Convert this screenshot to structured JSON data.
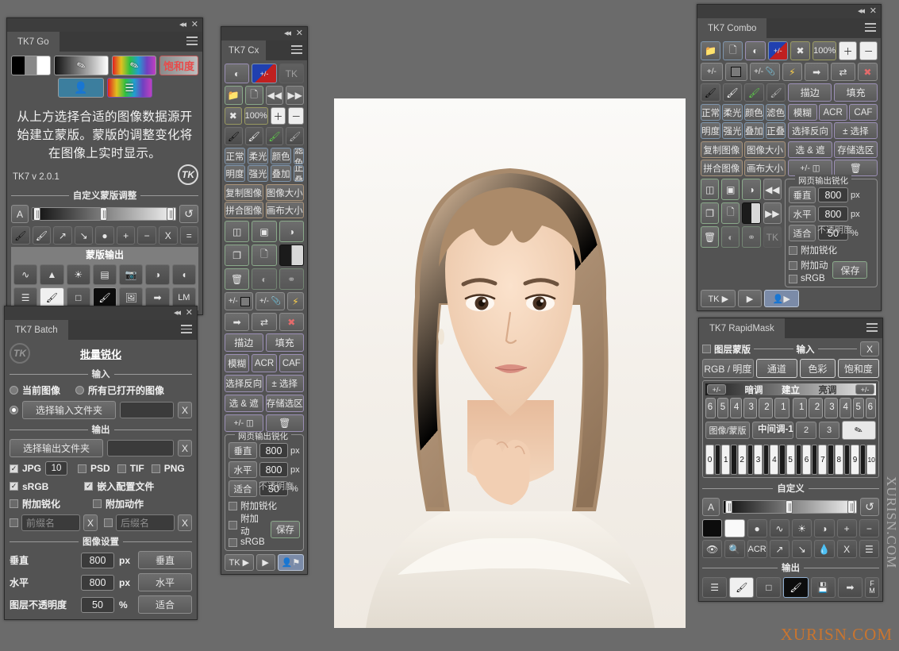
{
  "app": {
    "background": "#6b6b6b"
  },
  "watermark": {
    "text": "XURISN.COM",
    "vertical_text": "XURISN.COM",
    "color": "#d2762a"
  },
  "tk7go": {
    "title": "TK7 Go",
    "sources": [
      {
        "name": "bw-ramp",
        "label": ""
      },
      {
        "name": "luminosity-pipette",
        "label": ""
      },
      {
        "name": "color-pipette",
        "label": ""
      },
      {
        "name": "saturation",
        "label": "饱和度"
      },
      {
        "name": "person",
        "label": ""
      },
      {
        "name": "layers",
        "label": ""
      }
    ],
    "message": "从上方选择合适的图像数据源开始建立蒙版。蒙版的调整变化将在图像上实时显示。",
    "version": "TK7 v 2.0.1",
    "custom_title": "自定义蒙版调整",
    "slider_letter": "A",
    "slider_reset": "↺",
    "tool_row": [
      "brush-black",
      "brush-white",
      "expand",
      "contract",
      "invert",
      "+",
      "−",
      "X",
      "="
    ],
    "output_title": "蒙版输出",
    "output_row1": [
      "curves-icon",
      "levels-icon",
      "brightness-icon",
      "gradient-icon",
      "camera-icon",
      "color-fill-icon",
      "half-tone-icon"
    ],
    "output_row2": [
      "menu-icon",
      "brush-light-icon",
      "marquee-icon",
      "brush-dark-icon",
      "image-icon",
      "apply-icon",
      "LM"
    ]
  },
  "tk7batch": {
    "title": "TK7 Batch",
    "heading": "批量锐化",
    "input_title": "输入",
    "radio_current": "当前图像",
    "radio_allopen": "所有已打开的图像",
    "btn_input_folder": "选择输入文件夹",
    "input_path": "",
    "clear_x": "X",
    "output_title": "输出",
    "btn_output_folder": "选择输出文件夹",
    "output_path": "",
    "formats": [
      {
        "label": "JPG",
        "checked": true,
        "quality": "10"
      },
      {
        "label": "PSD",
        "checked": false
      },
      {
        "label": "TIF",
        "checked": false
      },
      {
        "label": "PNG",
        "checked": false
      }
    ],
    "srgb": {
      "label": "sRGB",
      "checked": true
    },
    "embed": {
      "label": "嵌入配置文件",
      "checked": true
    },
    "extra_sharpen": {
      "label": "附加锐化",
      "checked": false
    },
    "extra_action": {
      "label": "附加动作",
      "checked": false
    },
    "prefix_placeholder": "前缀名",
    "suffix_placeholder": "后缀名",
    "image_settings_title": "图像设置",
    "rows": [
      {
        "label": "垂直",
        "value": "800",
        "unit": "px",
        "button": "垂直"
      },
      {
        "label": "水平",
        "value": "800",
        "unit": "px",
        "button": "水平"
      },
      {
        "label": "图层不透明度",
        "value": "50",
        "unit": "%",
        "button": "适合"
      }
    ]
  },
  "tk7cx": {
    "title": "TK7 Cx",
    "row_top": [
      "curve-ball-icon",
      "plus-minus-color-icon",
      "tk-logo"
    ],
    "row_file": [
      "open-folder-icon",
      "new-doc-icon",
      "rewind-icon",
      "forward-icon"
    ],
    "row_zoom": [
      "fit-icon",
      "100%",
      "zoom-in-icon",
      "zoom-out-icon"
    ],
    "row_brush": [
      "brush-black-icon",
      "brush-white-icon",
      "brush-green-icon",
      "brush-gray-icon"
    ],
    "blend_row1": [
      "正常",
      "柔光",
      "颜色",
      "滤色"
    ],
    "blend_row2": [
      "明度",
      "强光",
      "叠加",
      "正叠"
    ],
    "image_ops": [
      "复制图像",
      "图像大小",
      "拼合图像",
      "画布大小"
    ],
    "layer_row1": [
      "new-layer-icon",
      "mask-layer-icon",
      "adjust-layer-icon"
    ],
    "layer_row2": [
      "duplicate-layer-icon",
      "copy-layer-icon",
      "split-layer-icon"
    ],
    "layer_row3": [
      "trash-icon",
      "merge-icon",
      "stamp-icon"
    ],
    "plus_row": [
      "+/- ▣",
      "+/- ⌯",
      "⚡"
    ],
    "arrow_row": [
      "apply-icon",
      "swap-icon",
      "X"
    ],
    "stroke_fill": [
      "描边",
      "填充"
    ],
    "blur_row": [
      "模糊",
      "ACR",
      "CAF"
    ],
    "select_row1": [
      "选择反向",
      "± 选择"
    ],
    "select_row2": [
      "选 & 遮",
      "存储选区"
    ],
    "select_row3": [
      "+/- ⌑",
      "trash-icon"
    ],
    "web_title": "网页输出锐化",
    "web_rows": [
      {
        "button": "垂直",
        "value": "800",
        "unit": "px"
      },
      {
        "button": "水平",
        "value": "800",
        "unit": "px"
      },
      {
        "button": "适合",
        "label": "不透明度",
        "value": "50",
        "unit": "%"
      }
    ],
    "web_checks": [
      {
        "label": "附加锐化",
        "checked": false
      },
      {
        "label": "附加动",
        "checked": false
      },
      {
        "label": "sRGB",
        "checked": false
      }
    ],
    "save_label": "保存",
    "footer": [
      "TK ▶",
      "▶",
      "person-flag-icon"
    ]
  },
  "tk7combo": {
    "title": "TK7 Combo",
    "row1": [
      "open-folder-icon",
      "new-doc-icon",
      "curve-ball-icon",
      "plus-minus-color-icon",
      "fit-icon",
      "100%",
      "zoom-in-icon",
      "zoom-out-icon"
    ],
    "row2": [
      "+/- ▣",
      "▣",
      "+/- ⌯",
      "⚡",
      "apply-icon",
      "swap-icon",
      "X"
    ],
    "row3_brushes": [
      "brush-black-icon",
      "brush-white-icon",
      "brush-green-icon",
      "brush-gray-icon"
    ],
    "stroke_fill": [
      "描边",
      "填充"
    ],
    "blur_row": [
      "模糊",
      "ACR",
      "CAF"
    ],
    "blend_row1": [
      "正常",
      "柔光",
      "颜色",
      "滤色"
    ],
    "blend_row2": [
      "明度",
      "强光",
      "叠加",
      "正叠"
    ],
    "select_row1": [
      "选择反向",
      "± 选择"
    ],
    "image_ops": [
      "复制图像",
      "图像大小",
      "拼合图像",
      "画布大小"
    ],
    "select_row2": [
      "选 & 遮",
      "存储选区"
    ],
    "select_row3": [
      "+/- ⌑",
      "trash-icon"
    ],
    "layer_row1": [
      "new-layer-icon",
      "mask-layer-icon",
      "adjust-layer-icon",
      "rewind-icon"
    ],
    "layer_row2": [
      "duplicate-layer-icon",
      "copy-layer-icon",
      "split-layer-icon",
      "forward-icon"
    ],
    "layer_row3": [
      "trash-icon",
      "merge-icon",
      "stamp-icon",
      "tk-logo"
    ],
    "web_title": "网页输出锐化",
    "web_rows": [
      {
        "button": "垂直",
        "value": "800",
        "unit": "px"
      },
      {
        "button": "水平",
        "value": "800",
        "unit": "px"
      },
      {
        "button": "适合",
        "label": "不透明度",
        "value": "50",
        "unit": "%"
      }
    ],
    "web_checks": [
      {
        "label": "附加锐化",
        "checked": false
      },
      {
        "label": "附加动",
        "checked": false
      },
      {
        "label": "sRGB",
        "checked": false
      }
    ],
    "save_label": "保存",
    "footer": [
      "TK ▶",
      "▶",
      "person-flag-icon"
    ]
  },
  "tk7rm": {
    "title": "TK7 RapidMask",
    "layer_mask": {
      "label": "图层蒙版",
      "checked": false
    },
    "input_title": "输入",
    "clear_x": "X",
    "mode_buttons": [
      "RGB / 明度",
      "通道",
      "色彩",
      "饱和度"
    ],
    "ramp_left_badge": "+/-",
    "ramp_right_badge": "+/-",
    "ramp_dark": "暗调",
    "ramp_build": "建立",
    "ramp_light": "亮调",
    "dark_keys": [
      "6",
      "5",
      "4",
      "3",
      "2",
      "1"
    ],
    "light_keys": [
      "1",
      "2",
      "3",
      "4",
      "5",
      "6"
    ],
    "image_mask_label": "图像/蒙版",
    "mid_label": "中间调-1",
    "mid_keys": [
      "2",
      "3"
    ],
    "pipette_icon": "eyedropper-icon",
    "piano_labels": [
      "0",
      "1",
      "2",
      "3",
      "4",
      "5",
      "6",
      "7",
      "8",
      "9",
      "10"
    ],
    "custom_title": "自定义",
    "slider_letter": "A",
    "slider_reset": "↺",
    "tool_row1": [
      "black-swatch",
      "white-swatch",
      "circle-icon",
      "curves-icon",
      "brightness-icon",
      "invert-icon",
      "+",
      "−"
    ],
    "tool_row2": [
      "eye-icon",
      "magnifier-icon",
      "ACR",
      "expand-icon",
      "contract-icon",
      "drop-icon",
      "X",
      "menu-icon"
    ],
    "output_title": "输出",
    "output_row": [
      "menu-icon",
      "brush-light-icon",
      "marquee-icon",
      "brush-dark-icon",
      "save-icon",
      "apply-icon",
      "F M"
    ]
  }
}
